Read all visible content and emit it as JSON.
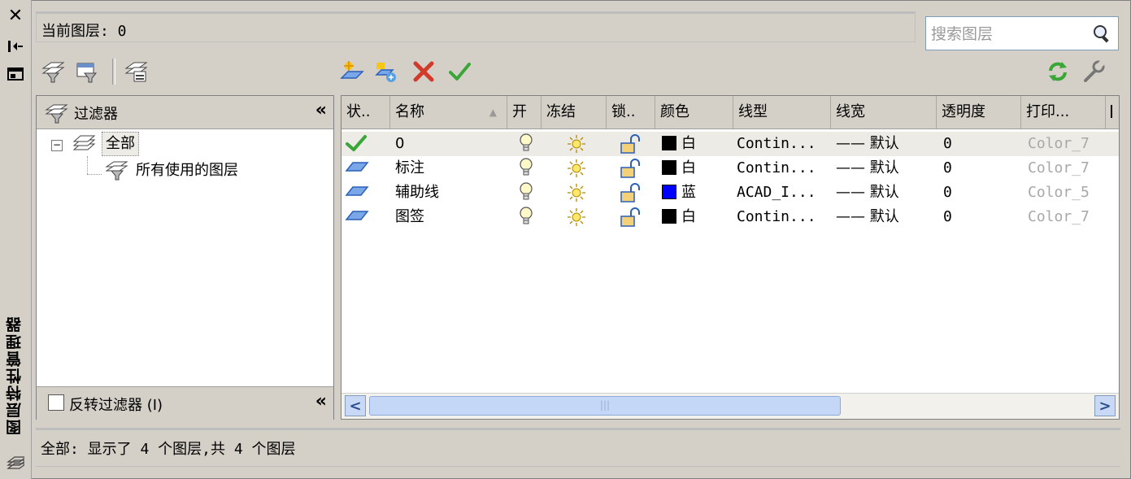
{
  "window": {
    "side_title": "图层特性管理器"
  },
  "header": {
    "current_layer_label": "当前图层: 0",
    "search_placeholder": "搜索图层"
  },
  "filter_panel": {
    "title": "过滤器",
    "tree": [
      {
        "label": "全部",
        "selected": true
      },
      {
        "label": "所有使用的图层",
        "selected": false
      }
    ],
    "invert_label": "反转过滤器 (I)",
    "invert_checked": false
  },
  "layer_table": {
    "columns": [
      "状..",
      "名称",
      "开",
      "冻结",
      "锁..",
      "颜色",
      "线型",
      "线宽",
      "透明度",
      "打印..."
    ],
    "rows": [
      {
        "status": "current",
        "name": "0",
        "color_hex": "#000000",
        "color_name": "白",
        "linetype": "Contin...",
        "lineweight": "—— 默认",
        "transparency": "0",
        "plot_style": "Color_7"
      },
      {
        "status": "layer",
        "name": "标注",
        "color_hex": "#000000",
        "color_name": "白",
        "linetype": "Contin...",
        "lineweight": "—— 默认",
        "transparency": "0",
        "plot_style": "Color_7"
      },
      {
        "status": "layer",
        "name": "辅助线",
        "color_hex": "#0000ff",
        "color_name": "蓝",
        "linetype": "ACAD_I...",
        "lineweight": "—— 默认",
        "transparency": "0",
        "plot_style": "Color_5"
      },
      {
        "status": "layer",
        "name": "图签",
        "color_hex": "#000000",
        "color_name": "白",
        "linetype": "Contin...",
        "lineweight": "—— 默认",
        "transparency": "0",
        "plot_style": "Color_7"
      }
    ]
  },
  "status_bar": {
    "text": "全部: 显示了 4 个图层,共 4 个图层"
  },
  "colors": {
    "panel_bg": "#d4d0c8",
    "accent_green": "#3aa637",
    "delete_red": "#d23a2a",
    "layer_blue": "#2c5fb8",
    "scroll_blue": "#c5d7f7"
  }
}
